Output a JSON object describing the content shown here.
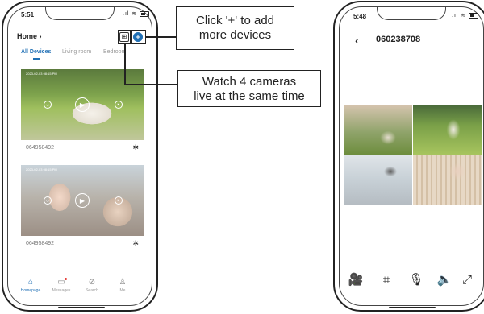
{
  "left_phone": {
    "time": "5:51",
    "header": {
      "title": "Home",
      "chevron": "›"
    },
    "icons": {
      "grid": "grid-view-icon",
      "add": "add-device-icon"
    },
    "tabs": [
      {
        "label": "All Devices",
        "active": true
      },
      {
        "label": "Living room",
        "active": false
      },
      {
        "label": "Bedroom",
        "active": false
      }
    ],
    "devices": [
      {
        "id": "064958492",
        "timestamp": "2023-02-03 08:15 PM"
      },
      {
        "id": "064958492",
        "timestamp": "2023-02-03 08:15 PM"
      }
    ],
    "nav": [
      {
        "label": "Homepage",
        "icon": "home-icon",
        "active": true
      },
      {
        "label": "Messages",
        "icon": "message-icon",
        "active": false,
        "has_dot": true
      },
      {
        "label": "Search",
        "icon": "search-icon",
        "active": false
      },
      {
        "label": "Me",
        "icon": "person-icon",
        "active": false
      }
    ],
    "accent_color": "#1f6fb5"
  },
  "callouts": {
    "add": "Click '+' to add more devices",
    "add_line1": "Click '+' to add",
    "add_line2": "more devices",
    "multi_line1": "Watch 4 cameras",
    "multi_line2": "live at the same time"
  },
  "right_phone": {
    "time": "5:48",
    "title": "060238708",
    "actions": [
      "video-record-icon",
      "screenshot-icon",
      "microphone-icon",
      "speaker-icon",
      "fullscreen-icon"
    ]
  }
}
